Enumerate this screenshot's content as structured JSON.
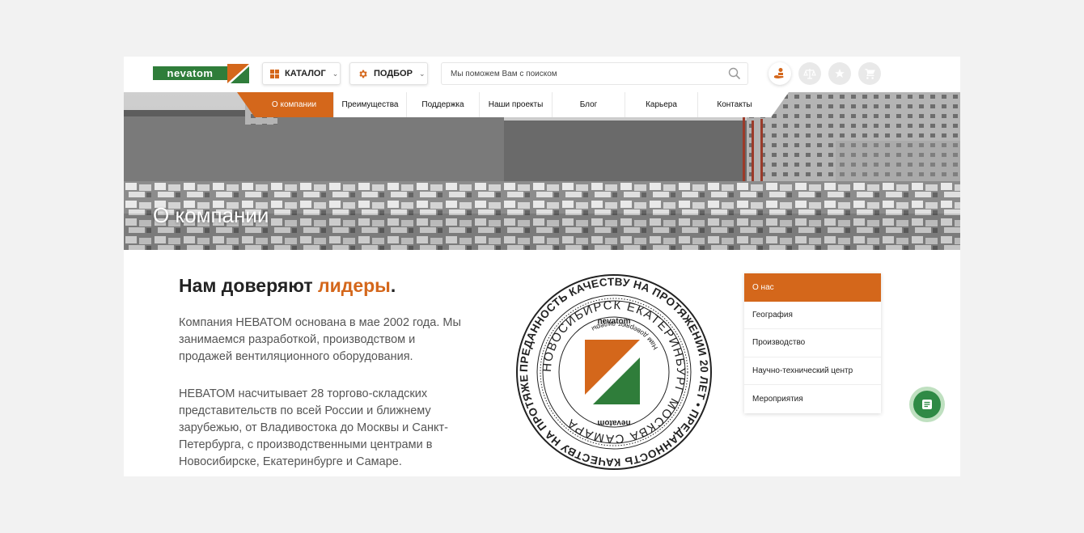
{
  "header": {
    "logo_text": "nevatom",
    "catalog_label": "КАТАЛОГ",
    "select_label": "ПОДБОР",
    "search_placeholder": "Мы поможем Вам с поиском"
  },
  "nav": {
    "items": [
      {
        "label": "О компании"
      },
      {
        "label": "Преимущества"
      },
      {
        "label": "Поддержка"
      },
      {
        "label": "Наши проекты"
      },
      {
        "label": "Блог"
      },
      {
        "label": "Карьера"
      },
      {
        "label": "Контакты"
      }
    ]
  },
  "hero": {
    "title": "О компании"
  },
  "content": {
    "heading_prefix": "Нам доверяют ",
    "heading_accent": "лидеры",
    "heading_suffix": ".",
    "paragraph_1": "Компания НЕВАТОМ основана в мае 2002 года. Мы занимаемся разработкой, производством и продажей вентиляционного оборудования.",
    "paragraph_2": "НЕВАТОМ насчитывает 28 торгово-складских представительств по всей России и ближнему зарубежью, от Владивостока до Москвы и Санкт-Петербурга, с производственными центрами в Новосибирске, Екатеринбурге и Самаре."
  },
  "seal": {
    "outer_text": "ПРЕДАННОСТЬ КАЧЕСТВУ НА ПРОТЯЖЕНИИ 20 ЛЕТ • ПРЕДАННОСТЬ КАЧЕСТВУ НА ПРОТЯЖЕНИИ 20 ЛЕТ •",
    "cities_text": "НОВОСИБИРСК ЕКАТЕРИНБУРГ МОСКВА САМАРА",
    "motto_text": "Нам доверяют лидеры",
    "brand_top": "nevatom",
    "brand_bottom": "nevatom"
  },
  "sidebar": {
    "items": [
      {
        "label": "О нас"
      },
      {
        "label": "География"
      },
      {
        "label": "Производство"
      },
      {
        "label": "Научно-технический центр"
      },
      {
        "label": "Мероприятия"
      }
    ]
  },
  "colors": {
    "accent": "#d4671b",
    "brand_green": "#2f7d3a",
    "fab_green": "#2f8a45"
  },
  "icons": {
    "catalog": "grid-icon",
    "select": "gear-icon",
    "search": "search-icon",
    "profile": "hand-user-icon",
    "compare": "scales-icon",
    "favorites": "star-icon",
    "cart": "cart-icon",
    "chat": "chat-icon"
  }
}
